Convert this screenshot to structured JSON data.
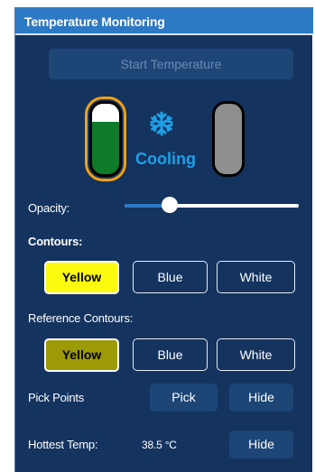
{
  "panel": {
    "title": "Temperature Monitoring"
  },
  "start_button": {
    "label": "Start Temperature"
  },
  "status": {
    "label": "Cooling"
  },
  "opacity": {
    "label": "Opacity:",
    "value": 0.26
  },
  "contours": {
    "label": "Contours:",
    "options": [
      "Yellow",
      "Blue",
      "White"
    ],
    "selected": "Yellow"
  },
  "reference_contours": {
    "label": "Reference Contours:",
    "options": [
      "Yellow",
      "Blue",
      "White"
    ],
    "selected": "Yellow"
  },
  "pick_points": {
    "label": "Pick Points",
    "pick_label": "Pick",
    "hide_label": "Hide"
  },
  "hottest_temp": {
    "label": "Hottest Temp:",
    "value": "38.5 °C",
    "hide_label": "Hide"
  },
  "colors": {
    "titlebar": "#2e79c4",
    "panel": "#14335f",
    "accent_orange": "#f3a112",
    "canister_green": "#0f7a2a",
    "canister_gray": "#8f8f8f",
    "cooling_blue": "#1da1e8",
    "yellow": "#fbfa0f",
    "olive": "#9c9a06"
  }
}
